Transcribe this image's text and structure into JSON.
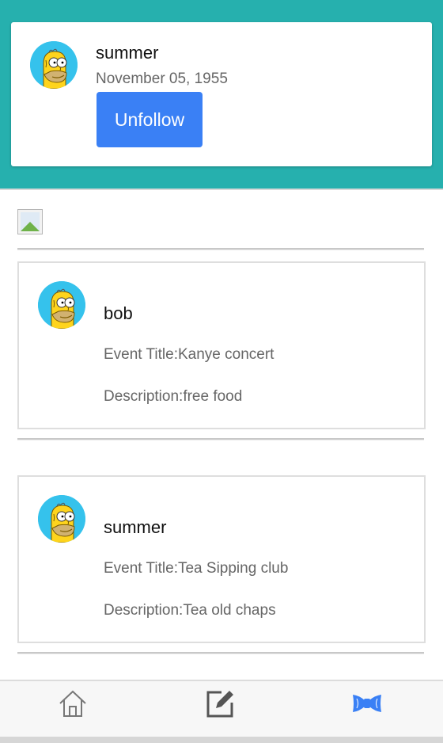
{
  "profile": {
    "name": "summer",
    "date": "November 05, 1955",
    "unfollow_label": "Unfollow",
    "avatar_icon": "homer-avatar-icon"
  },
  "events": [
    {
      "user": "bob",
      "title": "Event Title:Kanye concert",
      "description": "Description:free food"
    },
    {
      "user": "summer",
      "title": "Event Title:Tea Sipping club",
      "description": "Description:Tea old chaps"
    }
  ],
  "nav": {
    "items": [
      "home-icon",
      "edit-icon",
      "bowtie-icon"
    ],
    "active": "bowtie-icon"
  },
  "colors": {
    "header": "#26b0ae",
    "button": "#3a80f5",
    "nav_active": "#3a80f5",
    "nav_inactive": "#777777"
  }
}
